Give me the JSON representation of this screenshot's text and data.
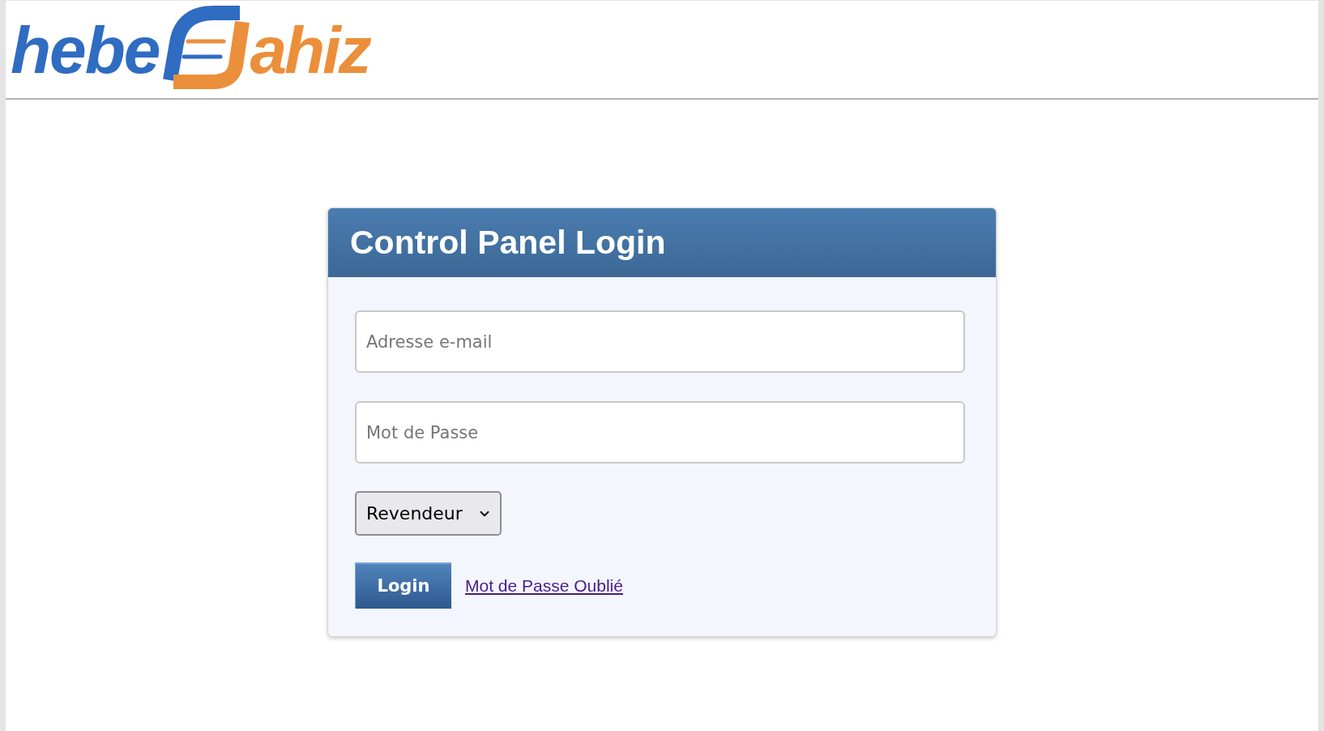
{
  "header": {
    "logo": {
      "text_start": "hebe",
      "text_end": "ahiz"
    }
  },
  "login_panel": {
    "title": "Control Panel Login",
    "fields": [
      {
        "placeholder": "Adresse e-mail"
      },
      {
        "placeholder": "Mot de Passe"
      }
    ],
    "account_type_select": {
      "value": "Revendeur"
    },
    "login_button": "Login",
    "forgot_password_link": "Mot de Passe Oublié"
  }
}
